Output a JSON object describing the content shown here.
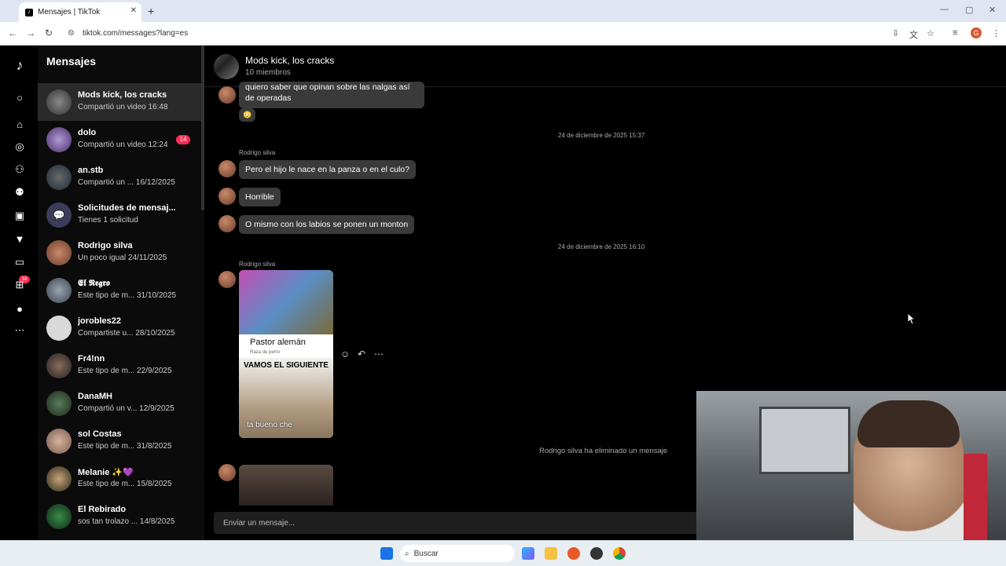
{
  "browser": {
    "tab_title": "Mensajes | TikTok",
    "tab_close": "✕",
    "new_tab": "+",
    "url": "tiktok.com/messages?lang=es",
    "win_min": "—",
    "win_max": "▢",
    "win_close": "✕",
    "profile_initial": "G"
  },
  "nav": {
    "notif_count": "16"
  },
  "sidebar": {
    "title": "Mensajes",
    "conversations": [
      {
        "name": "Mods kick, los cracks",
        "sub": "Compartió un video 16:48",
        "active": true
      },
      {
        "name": "dolo",
        "sub": "Compartió un video 12:24",
        "badge": "14"
      },
      {
        "name": "an.stb",
        "sub": "Compartió un ...  16/12/2025"
      },
      {
        "name": "Solicitudes de mensaj...",
        "sub": "Tienes 1 solicitud"
      },
      {
        "name": "Rodrigo silva",
        "sub": "Un poco igual 24/11/2025"
      },
      {
        "name": "𝕰𝖑 𝕹𝖊𝖌𝖗𝖔",
        "sub": "Este tipo de m... 31/10/2025"
      },
      {
        "name": "jorobles22",
        "sub": "Compartiste u... 28/10/2025"
      },
      {
        "name": "Fr4!nn",
        "sub": "Este tipo de m... 22/9/2025"
      },
      {
        "name": "DanaMH",
        "sub": "Compartió un v... 12/9/2025"
      },
      {
        "name": "sol Costas",
        "sub": "Este tipo de m... 31/8/2025"
      },
      {
        "name": "Melanie ✨💜",
        "sub": "Este tipo de m... 15/8/2025"
      },
      {
        "name": "El Rebirado",
        "sub": "sos tan trolazo ... 14/8/2025"
      }
    ]
  },
  "chat": {
    "group_name": "Mods kick, los cracks",
    "members": "10 miembros",
    "partial_message": "quiero saber que opinan sobre las nalgas así de operadas",
    "reaction": "😳",
    "timestamp1": "24 de diciembre de 2025 15:37",
    "sender1": "Rodrigo silva",
    "msg1": "Pero el hijo le nace en la panza o en el culo?",
    "msg2": "Horrible",
    "msg3": "O mismo con los labios se ponen un monton",
    "timestamp2": "24 de diciembre de 2025 16:10",
    "sender2": "Rodrigo silva",
    "media": {
      "caption1": "Pastor alemán",
      "caption2": "Raza de perro",
      "caption3": "VAMOS EL SIGUIENTE",
      "caption4": "ta bueno che"
    },
    "system_msg": "Rodrigo silva ha eliminado un mensaje",
    "input_placeholder": "Enviar un mensaje..."
  },
  "taskbar": {
    "search_label": "Buscar"
  },
  "colors": {
    "accent": "#fe2c55",
    "bubble": "#3a3a3a",
    "background": "#000000"
  }
}
